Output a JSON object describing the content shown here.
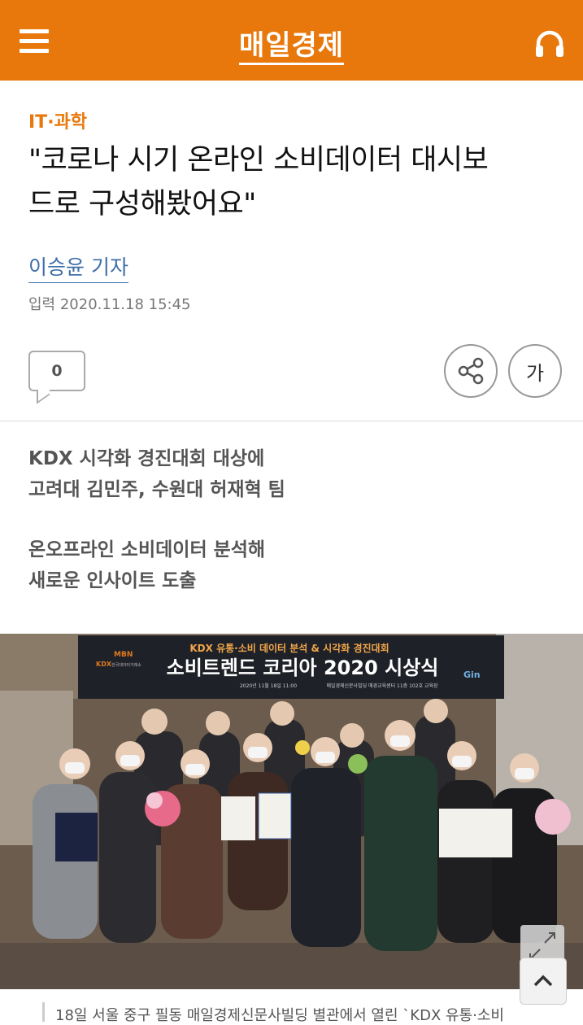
{
  "header": {
    "logo": "매일경제",
    "menu_icon": "hamburger-icon",
    "audio_icon": "headphone-icon"
  },
  "article": {
    "section": "IT·과학",
    "title_line1": "\"코로나 시기 온라인 소비데이터 대시보",
    "title_line2": "드로 구성해봤어요\"",
    "reporter": "이승윤 기자",
    "date": "입력 2020.11.18 15:45",
    "comment_count": "0",
    "font_size_label": "가",
    "subtitles": [
      [
        "KDX 시각화 경진대회 대상에",
        "고려대 김민주, 수원대 허재혁 팀"
      ],
      [
        "온오프라인 소비데이터 분석해",
        "새로운 인사이트 도출"
      ]
    ],
    "photo": {
      "banner_top": "KDX 유통·소비 데이터 분석 & 시각화 경진대회",
      "banner_main": "소비트렌드 코리아 2020 시상식",
      "banner_left_brand1": "MBN",
      "banner_left_brand2": "KDX",
      "banner_left_small": "한국데이터거래소",
      "banner_right_brand": "Gin",
      "banner_date": "2020년 11월 18일 11:00",
      "banner_place": "매일경제신문사빌딩 매경교육센터 11층 102호 교육장"
    },
    "caption": "18일 서울 중구 필동 매일경제신문사빌딩 별관에서 열린 `KDX 유통·소비"
  },
  "colors": {
    "brand_orange": "#e8780b",
    "reporter_blue": "#3f6ea8"
  },
  "icons": {
    "share": "share-icon",
    "expand": "expand-icon",
    "scroll_top": "chevron-up-icon",
    "comment": "comment-icon"
  }
}
